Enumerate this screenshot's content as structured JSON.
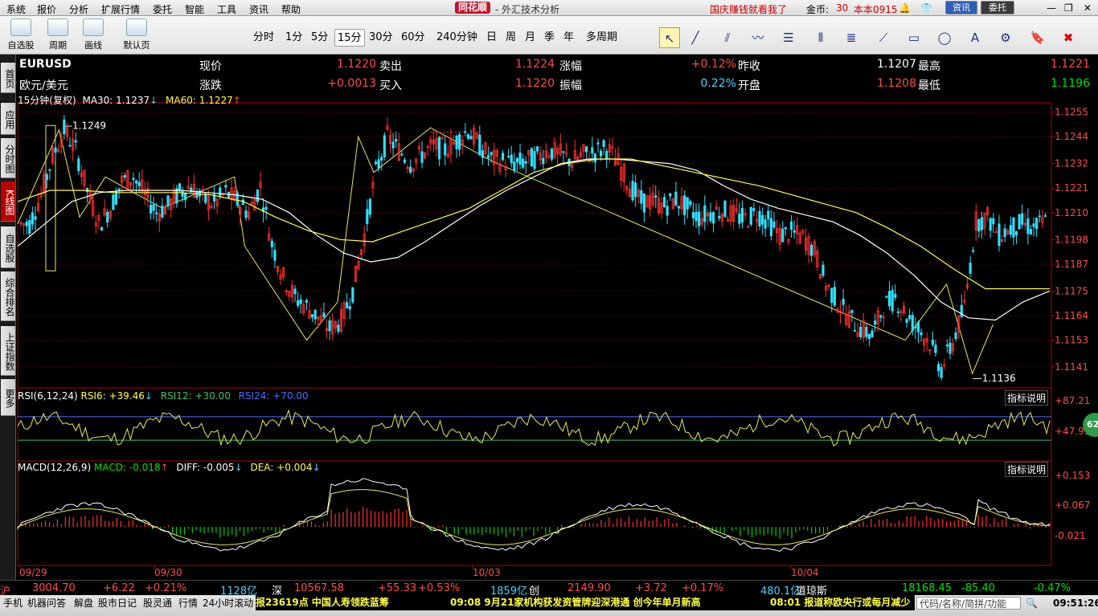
{
  "menu": {
    "items": [
      "系统",
      "报价",
      "分析",
      "扩展行情",
      "委托",
      "智能",
      "工具",
      "资讯",
      "帮助"
    ]
  },
  "title": {
    "logo": "同花顺",
    "app": "- 外汇技术分析"
  },
  "promo": "国庆赚钱就看我了",
  "gold_label": "金币:",
  "gold_value": "30",
  "version": "本本0915",
  "win_buttons": {
    "info": "资讯",
    "trade": "委托"
  },
  "toolbar": {
    "big": [
      {
        "label": "自选股"
      },
      {
        "label": "周期"
      },
      {
        "label": "画线"
      },
      {
        "label": "默认页"
      }
    ],
    "periods": [
      "分时",
      "1分",
      "5分",
      "15分",
      "30分",
      "60分",
      "240分钟",
      "日",
      "周",
      "月",
      "季",
      "年",
      "多周期"
    ],
    "selected_period": "15分"
  },
  "side_tabs": [
    "首页",
    "应用",
    "分时图",
    "K线图",
    "自选股",
    "综合排名",
    "上证指数",
    "更多"
  ],
  "quote": {
    "symbol": "EURUSD",
    "name": "欧元/美元",
    "row1": [
      {
        "label": "现价",
        "value": "1.1220",
        "color": "#ff4b4b"
      },
      {
        "label": "卖出",
        "value": "1.1224",
        "color": "#ff4b4b"
      },
      {
        "label": "涨幅",
        "value": "+0.12%",
        "color": "#ff4b4b"
      },
      {
        "label": "昨收",
        "value": "1.1207",
        "color": "#ffffff"
      },
      {
        "label": "最高",
        "value": "1.1221",
        "color": "#ff4b4b"
      }
    ],
    "row2": [
      {
        "label": "涨跌",
        "value": "+0.0013",
        "color": "#ff4b4b"
      },
      {
        "label": "买入",
        "value": "1.1220",
        "color": "#ff4b4b"
      },
      {
        "label": "振幅",
        "value": "0.22%",
        "color": "#49d1ff"
      },
      {
        "label": "开盘",
        "value": "1.1208",
        "color": "#ff4b4b"
      },
      {
        "label": "最低",
        "value": "1.1196",
        "color": "#00e000"
      }
    ]
  },
  "ma_legend": {
    "period": "15分钟(复权)",
    "ma30": "MA30: 1.1237",
    "ma60": "MA60: 1.1227"
  },
  "rsi_legend": {
    "name": "RSI(6,12,24)",
    "rsi6": "RSI6: +39.46",
    "rsi12": "RSI12: +30.00",
    "rsi24": "RSI24: +70.00",
    "help": "指标说明"
  },
  "macd_legend": {
    "name": "MACD(12,26,9)",
    "macd": "MACD: -0.018",
    "diff": "DIFF: -0.005",
    "dea": "DEA: +0.004",
    "help": "指标说明"
  },
  "badge": "62",
  "chart_data": {
    "type": "candlestick",
    "symbol": "EURUSD",
    "interval": "15min",
    "x_labels": [
      "09/29",
      "09/30",
      "10/03",
      "10/04"
    ],
    "price_ticks": [
      1.1255,
      1.1244,
      1.1232,
      1.1221,
      1.121,
      1.1198,
      1.1187,
      1.1175,
      1.1164,
      1.1153,
      1.1141
    ],
    "ylim": [
      1.1132,
      1.1257
    ],
    "annotations": {
      "high": "1.1249",
      "low": "1.1136"
    },
    "close_trace": [
      1.1205,
      1.1218,
      1.1235,
      1.1247,
      1.1238,
      1.122,
      1.1205,
      1.1212,
      1.1224,
      1.1226,
      1.1218,
      1.121,
      1.1213,
      1.1219,
      1.1222,
      1.1216,
      1.1214,
      1.1219,
      1.1215,
      1.121,
      1.1222,
      1.1196,
      1.1181,
      1.1172,
      1.1168,
      1.1163,
      1.1158,
      1.1162,
      1.1175,
      1.12,
      1.1228,
      1.1244,
      1.1238,
      1.1232,
      1.1236,
      1.124,
      1.1238,
      1.1242,
      1.1247,
      1.124,
      1.1234,
      1.1233,
      1.1232,
      1.1233,
      1.1235,
      1.1238,
      1.1236,
      1.1233,
      1.1236,
      1.1237,
      1.1239,
      1.1232,
      1.1222,
      1.1215,
      1.1215,
      1.1213,
      1.1216,
      1.1212,
      1.1208,
      1.121,
      1.1211,
      1.1209,
      1.1207,
      1.121,
      1.1206,
      1.12,
      1.1201,
      1.1199,
      1.1193,
      1.1178,
      1.117,
      1.1163,
      1.1158,
      1.1155,
      1.1168,
      1.1172,
      1.1164,
      1.1158,
      1.1152,
      1.114,
      1.1152,
      1.1168,
      1.1206,
      1.1208,
      1.12,
      1.1203,
      1.1205,
      1.1203,
      1.1206
    ],
    "ma30_trace": [
      1.1195,
      1.1205,
      1.1215,
      1.1219,
      1.122,
      1.122,
      1.122,
      1.1219,
      1.1218,
      1.1216,
      1.121,
      1.12,
      1.1192,
      1.1188,
      1.119,
      1.1197,
      1.1205,
      1.1213,
      1.122,
      1.1226,
      1.1232,
      1.1234,
      1.1234,
      1.1233,
      1.1232,
      1.1229,
      1.1222,
      1.1216,
      1.1212,
      1.1209,
      1.1206,
      1.12,
      1.1192,
      1.1182,
      1.117,
      1.1163,
      1.1162,
      1.117,
      1.1175
    ],
    "ma60_trace": [
      1.1215,
      1.122,
      1.122,
      1.1219,
      1.1219,
      1.1219,
      1.1218,
      1.1215,
      1.1208,
      1.1202,
      1.1198,
      1.1197,
      1.1202,
      1.1207,
      1.1212,
      1.122,
      1.1228,
      1.1232,
      1.1234,
      1.1234,
      1.1231,
      1.1228,
      1.1225,
      1.1222,
      1.1218,
      1.1214,
      1.121,
      1.1203,
      1.1195,
      1.1185,
      1.1176,
      1.1176,
      1.1176
    ],
    "rsi_ticks": [
      "+87.21",
      "+47.95"
    ],
    "macd_ticks": [
      "+0.153",
      "+0.067",
      "-0.021"
    ]
  },
  "market": [
    {
      "label": "沪",
      "color": "#ff4b4b"
    },
    {
      "label": "3004.70",
      "color": "#ff4b4b"
    },
    {
      "label": "+6.22",
      "color": "#ff4b4b"
    },
    {
      "label": "+0.21%",
      "color": "#ff4b4b"
    },
    {
      "label": "1128亿",
      "color": "#49d1ff"
    },
    {
      "label": "深",
      "color": "#ffffff"
    },
    {
      "label": "10567.58",
      "color": "#ff4b4b"
    },
    {
      "label": "+55.33",
      "color": "#ff4b4b"
    },
    {
      "label": "+0.53%",
      "color": "#ff4b4b"
    },
    {
      "label": "1859亿",
      "color": "#49d1ff"
    },
    {
      "label": "创",
      "color": "#ffffff"
    },
    {
      "label": "2149.90",
      "color": "#ff4b4b"
    },
    {
      "label": "+3.72",
      "color": "#ff4b4b"
    },
    {
      "label": "+0.17%",
      "color": "#ff4b4b"
    },
    {
      "label": "480.1亿",
      "color": "#49d1ff"
    },
    {
      "label": "道琼斯",
      "color": "#ffffff"
    },
    {
      "label": "18168.45",
      "color": "#00e000"
    },
    {
      "label": "-85.40",
      "color": "#00e000"
    },
    {
      "label": "-0.47%",
      "color": "#00e000"
    }
  ],
  "bottom_tabs": [
    "手机",
    "机器问答",
    "解盘",
    "股市日记",
    "股灵通",
    "行情",
    "24小时滚动"
  ],
  "ticker": {
    "t1": "报23619点 中国人寿领跌蓝筹",
    "t2": "09:08 9月21家机构获发资管牌迎深港通 创今年单月新高",
    "t3": "08:01 报道称欧央行或每月减少"
  },
  "search_hint": "代码/名称/简拼/功能",
  "clock": "09:51:26"
}
